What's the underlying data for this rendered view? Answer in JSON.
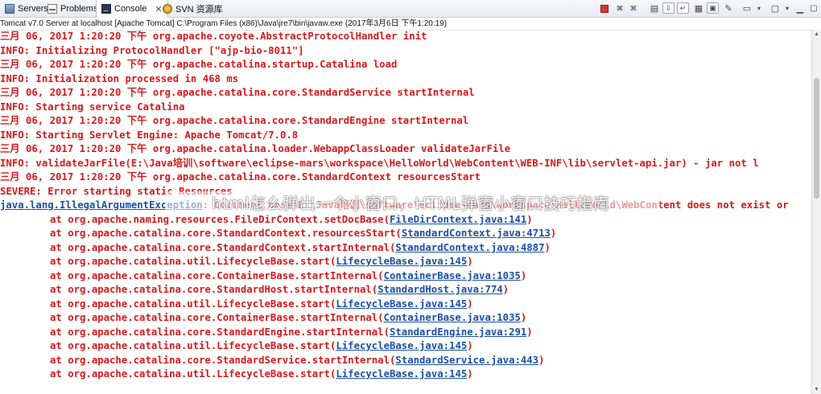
{
  "tabs": [
    {
      "label": "Servers",
      "icon": "servers-icon"
    },
    {
      "label": "Problems",
      "icon": "problems-icon"
    },
    {
      "label": "Console",
      "icon": "console-icon",
      "active": true
    },
    {
      "label": "SVN 资源库",
      "icon": "svn-icon"
    }
  ],
  "console_description": "Tomcat v7.0 Server at localhost [Apache Tomcat] C:\\Program Files (x86)\\Java\\jre7\\bin\\javaw.exe (2017年3月6日 下午1:20:19)",
  "console_lines": [
    "三月 06, 2017 1:20:20 下午 org.apache.coyote.AbstractProtocolHandler init",
    "INFO: Initializing ProtocolHandler [\"ajp-bio-8011\"]",
    "三月 06, 2017 1:20:20 下午 org.apache.catalina.startup.Catalina load",
    "INFO: Initialization processed in 468 ms",
    "三月 06, 2017 1:20:20 下午 org.apache.catalina.core.StandardService startInternal",
    "INFO: Starting service Catalina",
    "三月 06, 2017 1:20:20 下午 org.apache.catalina.core.StandardEngine startInternal",
    "INFO: Starting Servlet Engine: Apache Tomcat/7.0.8",
    "三月 06, 2017 1:20:20 下午 org.apache.catalina.loader.WebappClassLoader validateJarFile",
    "INFO: validateJarFile(E:\\Java培训\\software\\eclipse-mars\\workspace\\HelloWorld\\WebContent\\WEB-INF\\lib\\servlet-api.jar) - jar not l",
    "三月 06, 2017 1:20:20 下午 org.apache.catalina.core.StandardContext resourcesStart",
    "SEVERE: Error starting static Resources"
  ],
  "exception_line": {
    "exception_link": "java.lang.IllegalArgumentException",
    "rest": ": Document base E:\\Java培训\\software\\eclipse-mars\\workspace\\HelloWorld\\WebContent does not exist or"
  },
  "stack_frames": [
    {
      "text": "at org.apache.naming.resources.FileDirContext.setDocBase(",
      "link": "FileDirContext.java:141"
    },
    {
      "text": "at org.apache.catalina.core.StandardContext.resourcesStart(",
      "link": "StandardContext.java:4713"
    },
    {
      "text": "at org.apache.catalina.core.StandardContext.startInternal(",
      "link": "StandardContext.java:4887"
    },
    {
      "text": "at org.apache.catalina.util.LifecycleBase.start(",
      "link": "LifecycleBase.java:145"
    },
    {
      "text": "at org.apache.catalina.core.ContainerBase.startInternal(",
      "link": "ContainerBase.java:1035"
    },
    {
      "text": "at org.apache.catalina.core.StandardHost.startInternal(",
      "link": "StandardHost.java:774"
    },
    {
      "text": "at org.apache.catalina.util.LifecycleBase.start(",
      "link": "LifecycleBase.java:145"
    },
    {
      "text": "at org.apache.catalina.core.ContainerBase.startInternal(",
      "link": "ContainerBase.java:1035"
    },
    {
      "text": "at org.apache.catalina.core.StandardEngine.startInternal(",
      "link": "StandardEngine.java:291"
    },
    {
      "text": "at org.apache.catalina.util.LifecycleBase.start(",
      "link": "LifecycleBase.java:145"
    },
    {
      "text": "at org.apache.catalina.core.StandardService.startInternal(",
      "link": "StandardService.java:443"
    },
    {
      "text": "at org.apache.catalina.util.LifecycleBase.start(",
      "link": "LifecycleBase.java:145"
    }
  ],
  "watermark": "html怎么弹出一个小窗口，HTML弹窗小窗口技巧指南",
  "colors": {
    "stderr_text": "#d7191c",
    "link_text": "#1b4fa8",
    "toolbar_bg": "#e7eaf0"
  }
}
